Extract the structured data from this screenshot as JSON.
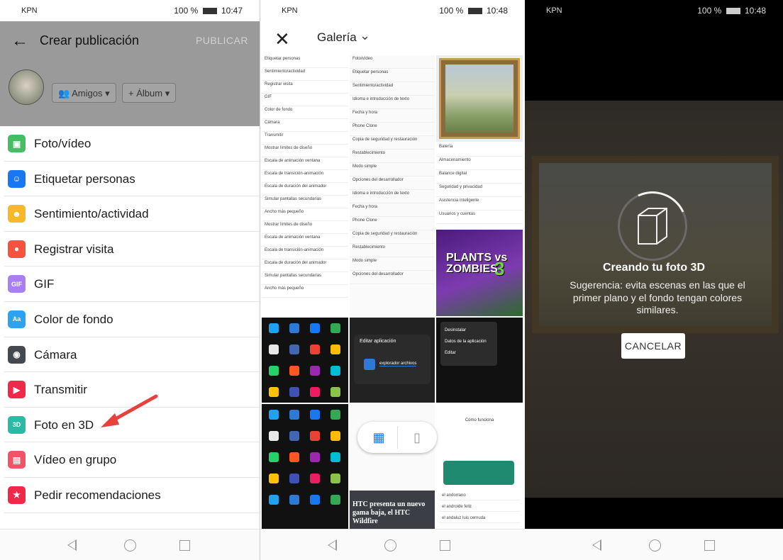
{
  "panel1": {
    "status": {
      "carrier": "KPN",
      "battery": "100 %",
      "time": "10:47"
    },
    "header": {
      "title": "Crear publicación",
      "publish": "PUBLICAR"
    },
    "audience": {
      "amigos": "Amigos",
      "album": "Álbum"
    },
    "menu": [
      {
        "label": "Foto/vídeo",
        "icon": "photo-icon",
        "color": "#45bd62"
      },
      {
        "label": "Etiquetar personas",
        "icon": "tag-people-icon",
        "color": "#1877f2"
      },
      {
        "label": "Sentimiento/actividad",
        "icon": "smiley-icon",
        "color": "#f7b928"
      },
      {
        "label": "Registrar visita",
        "icon": "location-pin-icon",
        "color": "#f5533d"
      },
      {
        "label": "GIF",
        "icon": "gif-icon",
        "color": "#a87ef0"
      },
      {
        "label": "Color de fondo",
        "icon": "background-color-icon",
        "color": "#2aa3f4"
      },
      {
        "label": "Cámara",
        "icon": "camera-icon",
        "color": "#444950"
      },
      {
        "label": "Transmitir",
        "icon": "live-video-icon",
        "color": "#f02849"
      },
      {
        "label": "Foto en 3D",
        "icon": "3d-photo-icon",
        "color": "#2abba7"
      },
      {
        "label": "Vídeo en grupo",
        "icon": "watch-party-icon",
        "color": "#f35369"
      },
      {
        "label": "Pedir recomendaciones",
        "icon": "recommendations-icon",
        "color": "#f02849"
      }
    ]
  },
  "panel2": {
    "status": {
      "carrier": "KPN",
      "battery": "100 %",
      "time": "10:48"
    },
    "header": {
      "title": "Galería"
    },
    "tiles": {
      "settings1": [
        "Etiquetar personas",
        "Sentimiento/actividad",
        "Registrar visita",
        "GIF",
        "Color de fondo",
        "Cámara",
        "Transmitir",
        "Mostrar límites de diseño",
        "Escala de animación ventana",
        "Escala de transición-animación",
        "Escala de duración del animador",
        "Simular pantallas secundarias",
        "Ancho más pequeño",
        "Mostrar límites de diseño",
        "Escala de animación ventana",
        "Escala de transición-animación",
        "Escala de duración del animador",
        "Simular pantallas secundarias",
        "Ancho más pequeño"
      ],
      "settings2": [
        "Foto/vídeo",
        "Etiquetar personas",
        "Sentimiento/actividad",
        "Idioma e introducción de texto",
        "Fecha y hora",
        "Phone Clone",
        "Copia de seguridad y restauración",
        "Restablecimiento",
        "Modo simple",
        "Opciones del desarrollador",
        "Idioma e introducción de texto",
        "Fecha y hora",
        "Phone Clone",
        "Copia de seguridad y restauración",
        "Restablecimiento",
        "Modo simple",
        "Opciones del desarrollador"
      ],
      "settings3": [
        "Batería",
        "Almacenamiento",
        "Balance digital",
        "Seguridad y privacidad",
        "Asistencia inteligente",
        "Usuarios y cuentas"
      ],
      "pvz_title": "PLANTS vs ZOMBIES",
      "pvz_num": "3",
      "edit_app": "Editar aplicación",
      "edit_app_field": "explorador archivos",
      "context_menu": [
        "Desinstalar",
        "Datos de la aplicación",
        "Editar"
      ],
      "whatsapp_title": "Cómo funciona",
      "whatsapp_items": [
        "el andorrano",
        "el androide feliz",
        "el andaluz luis cernuda"
      ],
      "htc_caption": "HTC presenta un nuevo gama baja, el HTC Wildfire"
    }
  },
  "panel3": {
    "status": {
      "carrier": "KPN",
      "battery": "100 %",
      "time": "10:48"
    },
    "creating": "Creando tu foto 3D",
    "suggestion": "Sugerencia: evita escenas en las que el primer plano y el fondo tengan colores similares.",
    "cancel": "CANCELAR"
  }
}
